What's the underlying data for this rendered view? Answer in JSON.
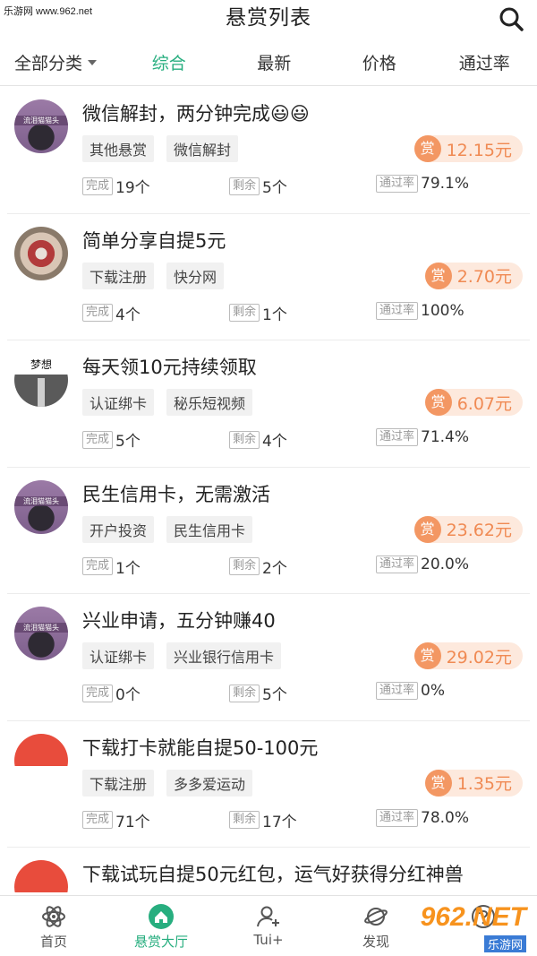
{
  "watermark_top": "乐游网 www.962.net",
  "header": {
    "title": "悬赏列表",
    "search_icon": "search-icon"
  },
  "filters": {
    "category": "全部分类",
    "tabs": [
      {
        "label": "综合",
        "active": true
      },
      {
        "label": "最新",
        "active": false
      },
      {
        "label": "价格",
        "active": false
      },
      {
        "label": "通过率",
        "active": false
      }
    ]
  },
  "labels": {
    "done": "完成",
    "remain": "剩余",
    "pass": "通过率",
    "shang": "赏"
  },
  "tasks": [
    {
      "title": "微信解封，两分钟完成😃😃",
      "tags": [
        "其他悬赏",
        "微信解封"
      ],
      "reward": "12.15元",
      "done": "19个",
      "remain": "5个",
      "pass": "79.1%",
      "avatar": "purple",
      "avatar_text": "流泪猫猫头"
    },
    {
      "title": "简单分享自提5元",
      "tags": [
        "下载注册",
        "快分网"
      ],
      "reward": "2.70元",
      "done": "4个",
      "remain": "1个",
      "pass": "100%",
      "avatar": "flower",
      "avatar_text": ""
    },
    {
      "title": "每天领10元持续领取",
      "tags": [
        "认证绑卡",
        "秘乐短视频"
      ],
      "reward": "6.07元",
      "done": "5个",
      "remain": "4个",
      "pass": "71.4%",
      "avatar": "road",
      "avatar_text": "梦想"
    },
    {
      "title": "民生信用卡，无需激活",
      "tags": [
        "开户投资",
        "民生信用卡"
      ],
      "reward": "23.62元",
      "done": "1个",
      "remain": "2个",
      "pass": "20.0%",
      "avatar": "purple",
      "avatar_text": "流泪猫猫头"
    },
    {
      "title": "兴业申请，五分钟赚40",
      "tags": [
        "认证绑卡",
        "兴业银行信用卡"
      ],
      "reward": "29.02元",
      "done": "0个",
      "remain": "5个",
      "pass": "0%",
      "avatar": "purple",
      "avatar_text": "流泪猫猫头"
    },
    {
      "title": "下载打卡就能自提50-100元",
      "tags": [
        "下载注册",
        "多多爱运动"
      ],
      "reward": "1.35元",
      "done": "71个",
      "remain": "17个",
      "pass": "78.0%",
      "avatar": "red",
      "avatar_text": ""
    },
    {
      "title": "下载试玩自提50元红包，运气好获得分红神兽",
      "tags": [],
      "reward": "",
      "done": "",
      "remain": "",
      "pass": "",
      "avatar": "red",
      "avatar_text": ""
    }
  ],
  "tabbar": {
    "items": [
      {
        "label": "首页",
        "icon": "atom-icon",
        "active": false
      },
      {
        "label": "悬赏大厅",
        "icon": "home-icon",
        "active": true
      },
      {
        "label": "Tui+",
        "icon": "add-user-icon",
        "active": false
      },
      {
        "label": "发现",
        "icon": "planet-icon",
        "active": false
      },
      {
        "label": "",
        "icon": "question-icon",
        "active": false
      }
    ]
  },
  "watermark_bottom": {
    "num": "962.NET",
    "sub": "乐游网"
  },
  "colors": {
    "accent": "#27ae7f",
    "reward": "#f08a53",
    "reward_bg": "#fde9dd",
    "shang": "#f39763"
  }
}
